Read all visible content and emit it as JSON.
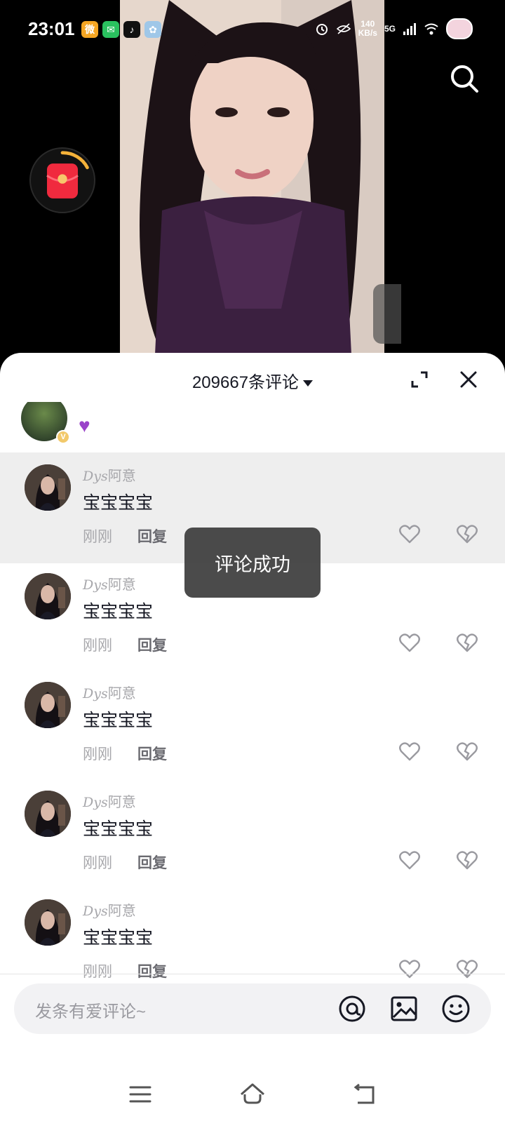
{
  "status_bar": {
    "time": "23:01",
    "apps": [
      {
        "name": "weibo-icon",
        "color": "#f5a623",
        "glyph": "微"
      },
      {
        "name": "wechat-icon",
        "color": "#2ac15f",
        "glyph": "✉"
      },
      {
        "name": "tiktok-icon",
        "color": "#111111",
        "glyph": "♪"
      },
      {
        "name": "gallery-icon",
        "color": "#9fc7e8",
        "glyph": "✿"
      }
    ],
    "speed_value": "140",
    "speed_unit": "KB/s",
    "network": "5G"
  },
  "comments_header": {
    "count_title": "209667条评论"
  },
  "comments": [
    {
      "username_script": "Dys",
      "username": "阿意",
      "content": "宝宝宝宝",
      "time": "刚刚",
      "reply": "回复",
      "highlighted": true
    },
    {
      "username_script": "Dys",
      "username": "阿意",
      "content": "宝宝宝宝",
      "time": "刚刚",
      "reply": "回复",
      "highlighted": false
    },
    {
      "username_script": "Dys",
      "username": "阿意",
      "content": "宝宝宝宝",
      "time": "刚刚",
      "reply": "回复",
      "highlighted": false
    },
    {
      "username_script": "Dys",
      "username": "阿意",
      "content": "宝宝宝宝",
      "time": "刚刚",
      "reply": "回复",
      "highlighted": false
    },
    {
      "username_script": "Dys",
      "username": "阿意",
      "content": "宝宝宝宝",
      "time": "刚刚",
      "reply": "回复",
      "highlighted": false
    }
  ],
  "toast": {
    "message": "评论成功"
  },
  "input": {
    "placeholder": "发条有爱评论~"
  },
  "colors": {
    "accent": "#fe2c55",
    "text_primary": "#161823",
    "text_secondary": "#a7a7ab"
  }
}
